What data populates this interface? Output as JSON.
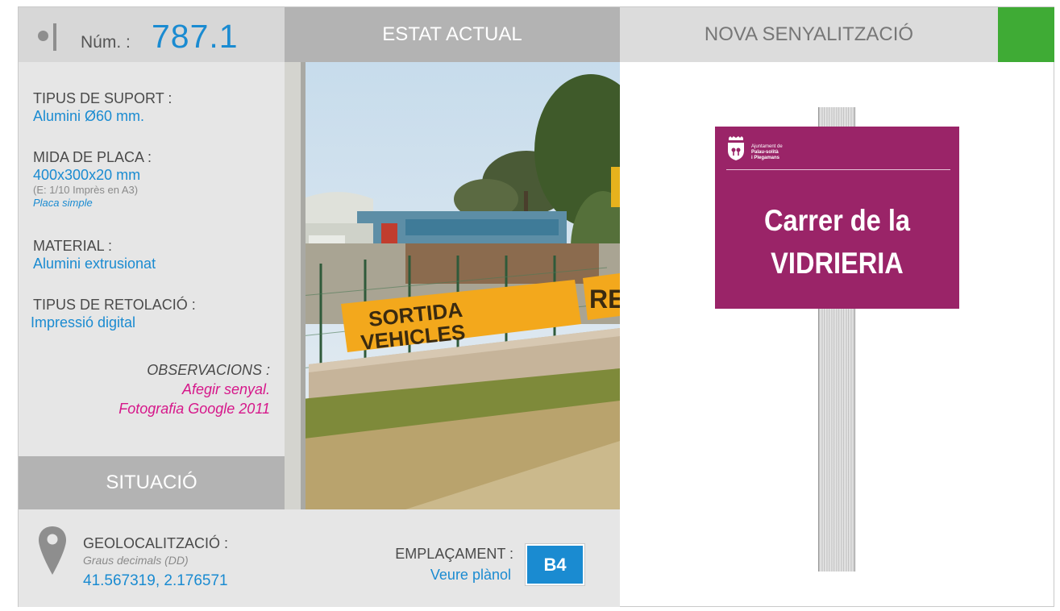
{
  "header": {
    "num_label": "Núm. :",
    "num_value": "787.1",
    "estat_actual": "ESTAT ACTUAL",
    "nova_senyalitzacio": "NOVA SENYALITZACIÓ",
    "accent_green": "#3fab35"
  },
  "details": {
    "tipus_suport_label": "TIPUS DE SUPORT :",
    "tipus_suport_value": "Alumini Ø60 mm.",
    "mida_placa_label": "MIDA DE PLACA :",
    "mida_placa_value": "400x300x20 mm",
    "mida_placa_note": "(E: 1/10 Imprès en A3)",
    "mida_placa_type": "Placa simple",
    "material_label": "MATERIAL :",
    "material_value": "Alumini extrusionat",
    "retolacio_label": "TIPUS DE RETOLACIÓ :",
    "retolacio_value": "Impressió digital",
    "observacions_label": "OBSERVACIONS :",
    "observacions_line1": "Afegir senyal.",
    "observacions_line2": "Fotografia Google 2011"
  },
  "situacio": {
    "title": "SITUACIÓ",
    "geo_label": "GEOLOCALITZACIÓ :",
    "geo_sub": "Graus decimals (DD)",
    "geo_value": "41.567319, 2.176571",
    "emplacament_label": "EMPLAÇAMENT :",
    "emplacament_link": "Veure plànol",
    "badge": "B4",
    "pin_icon": "map-pin-icon"
  },
  "photo": {
    "banner_text_1": "SORTIDA",
    "banner_text_2": "VEHICLES",
    "banner_text_3": "RE"
  },
  "sign": {
    "org_line1": "Ajuntament de",
    "org_line2": "Palau-solità",
    "org_line3": "i Plegamans",
    "street_line1": "Carrer de la",
    "street_line2": "VIDRIERIA",
    "plate_color": "#9a2468",
    "crest_icon": "municipal-crest-icon"
  },
  "colors": {
    "blue_value": "#1a8bd1",
    "magenta_observacions": "#d6178a"
  }
}
